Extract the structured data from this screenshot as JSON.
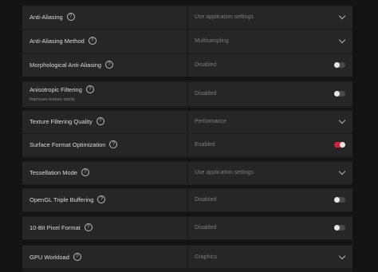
{
  "settings": [
    {
      "label": "Anti-Aliasing",
      "value": "Use application settings",
      "control": "dropdown"
    },
    {
      "label": "Anti-Aliasing Method",
      "value": "Multisampling",
      "control": "dropdown"
    },
    {
      "label": "Morphological Anti-Aliasing",
      "value": "Disabled",
      "control": "toggle",
      "on": false
    },
    {
      "label": "Anisotropic Filtering",
      "sublabel": "Improves texture clarity",
      "value": "Disabled",
      "control": "toggle",
      "on": false
    },
    {
      "label": "Texture Filtering Quality",
      "value": "Performance",
      "control": "dropdown"
    },
    {
      "label": "Surface Format Optimization",
      "value": "Enabled",
      "control": "toggle",
      "on": true
    },
    {
      "label": "Tessellation Mode",
      "value": "Use application settings",
      "control": "dropdown"
    },
    {
      "label": "OpenGL Triple Buffering",
      "value": "Disabled",
      "control": "toggle",
      "on": false
    },
    {
      "label": "10-Bit Pixel Format",
      "value": "Disabled",
      "control": "toggle",
      "on": false
    },
    {
      "label": "GPU Workload",
      "value": "Graphics",
      "control": "dropdown"
    }
  ],
  "help_glyph": "?",
  "colors": {
    "toggle_on": "#d3213a",
    "toggle_off": "#4a4a4a"
  }
}
